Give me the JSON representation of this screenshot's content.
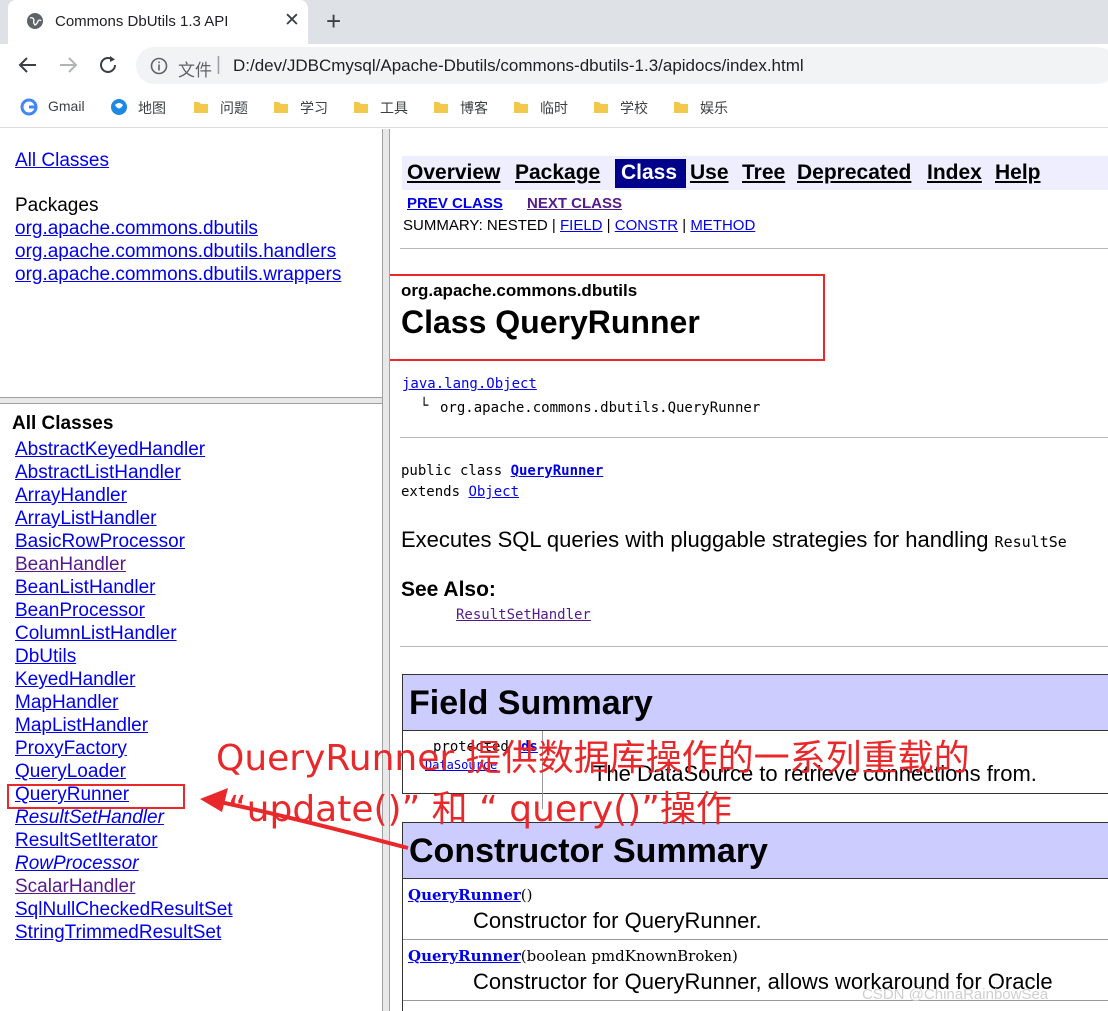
{
  "browser": {
    "tab_title": "Commons DbUtils 1.3 API",
    "url_prefix": "文件",
    "url": "D:/dev/JDBCmysql/Apache-Dbutils/commons-dbutils-1.3/apidocs/index.html",
    "bookmarks": [
      "Gmail",
      "地图",
      "问题",
      "学习",
      "工具",
      "博客",
      "临时",
      "学校",
      "娱乐"
    ]
  },
  "left_top": {
    "all_classes_link": "All Classes",
    "packages_label": "Packages",
    "packages": [
      "org.apache.commons.dbutils",
      "org.apache.commons.dbutils.handlers",
      "org.apache.commons.dbutils.wrappers"
    ]
  },
  "left_bottom": {
    "heading": "All Classes",
    "classes": [
      "AbstractKeyedHandler",
      "AbstractListHandler",
      "ArrayHandler",
      "ArrayListHandler",
      "BasicRowProcessor",
      "BeanHandler",
      "BeanListHandler",
      "BeanProcessor",
      "ColumnListHandler",
      "DbUtils",
      "KeyedHandler",
      "MapHandler",
      "MapListHandler",
      "ProxyFactory",
      "QueryLoader",
      "QueryRunner",
      "ResultSetHandler",
      "ResultSetIterator",
      "RowProcessor",
      "ScalarHandler",
      "SqlNullCheckedResultSet",
      "StringTrimmedResultSet"
    ]
  },
  "main": {
    "nav": {
      "overview": "Overview",
      "package": "Package",
      "class": "Class",
      "use": "Use",
      "tree": "Tree",
      "deprecated": "Deprecated",
      "index": "Index",
      "help": "Help"
    },
    "prev_class": "PREV CLASS",
    "next_class": "NEXT CLASS",
    "summary_prefix": "SUMMARY: NESTED | ",
    "summary_field": "FIELD",
    "summary_constr": "CONSTR",
    "summary_method": "METHOD",
    "package_name": "org.apache.commons.dbutils",
    "class_title": "Class QueryRunner",
    "hierarchy_parent": "java.lang.Object",
    "hierarchy_child": "org.apache.commons.dbutils.QueryRunner",
    "decl_public_class": "public class ",
    "decl_class_name": "QueryRunner",
    "decl_extends": "extends ",
    "decl_object": "Object",
    "description": "Executes SQL queries with pluggable strategies for handling ",
    "description_code": "ResultSe",
    "see_also_label": "See Also:",
    "see_also_link": "ResultSetHandler",
    "field_summary_title": "Field Summary",
    "field_modifier": "protected",
    "field_type_link": "DataSource",
    "field_name_link": "ds",
    "field_desc": "The DataSource to retrieve connections from.",
    "constructor_summary_title": "Constructor Summary",
    "constructors": [
      {
        "name": "QueryRunner",
        "params": "()",
        "desc": "Constructor for QueryRunner."
      },
      {
        "name": "QueryRunner",
        "params": "(boolean  pmdKnownBroken)",
        "desc": "Constructor for QueryRunner, allows workaround for Oracle"
      }
    ]
  },
  "annotation": {
    "line1": "QueryRunner 提供数据库操作的一系列重载的",
    "line2": "“update()” 和 “ query()”操作",
    "color": "#e8282b"
  },
  "watermark": "CSDN @ChinaRainbowSea"
}
